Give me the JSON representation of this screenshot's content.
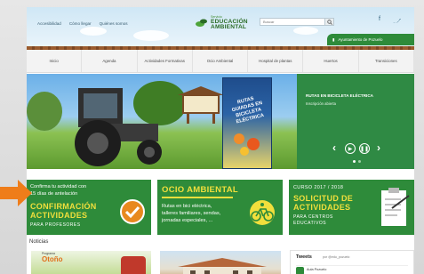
{
  "header": {
    "links": [
      "Accesibilidad",
      "Cómo llegar",
      "Quiénes somos"
    ],
    "logo_small": "Servicio",
    "logo_line1": "EDUCACIÓN",
    "logo_line2": "AMBIENTAL",
    "search_placeholder": "Buscar",
    "ayuntamiento": "Ayuntamiento de Pozuelo"
  },
  "nav": {
    "items": [
      "Inicio",
      "Agenda",
      "Actividades Formativas",
      "Ocio Ambiental",
      "Hospital de plantas",
      "Huertos",
      "Transiciones"
    ]
  },
  "hero": {
    "poster_text": "RUTAS GUIADAS EN BICICLETA ELÉCTRICA",
    "panel_title": "RUTAS EN BICICLETA ELÉCTRICA",
    "panel_sub": "Inscripción abierta"
  },
  "banners": {
    "b1_line1": "Confirma tu actividad con",
    "b1_line2": "15 días de antelación",
    "b1_big1": "CONFIRMACIÓN",
    "b1_big2": "ACTIVIDADES",
    "b1_small": "PARA PROFESORES",
    "b2_big": "OCIO AMBIENTAL",
    "b2_l1": "Rutas en bici eléctrica,",
    "b2_l2": "talleres familiares, sendas,",
    "b2_l3": "jornadas especiales, ...",
    "b3_course": "CURSO 2017 / 2018",
    "b3_big1": "SOLICITUD DE",
    "b3_big2": "ACTIVIDADES",
    "b3_small1": "PARA CENTROS",
    "b3_small2": "EDUCATIVOS"
  },
  "news": {
    "title": "Noticias",
    "thumb1_small": "Programa",
    "thumb1_text": "Otoño"
  },
  "tweets": {
    "title": "Tweets",
    "handle": "por @edu_pozuelo",
    "author": "Aula Pozuelo"
  },
  "colors": {
    "accent_green": "#2e8b3a",
    "highlight_yellow": "#f1df3c",
    "pointer_orange": "#ef7d1a"
  }
}
